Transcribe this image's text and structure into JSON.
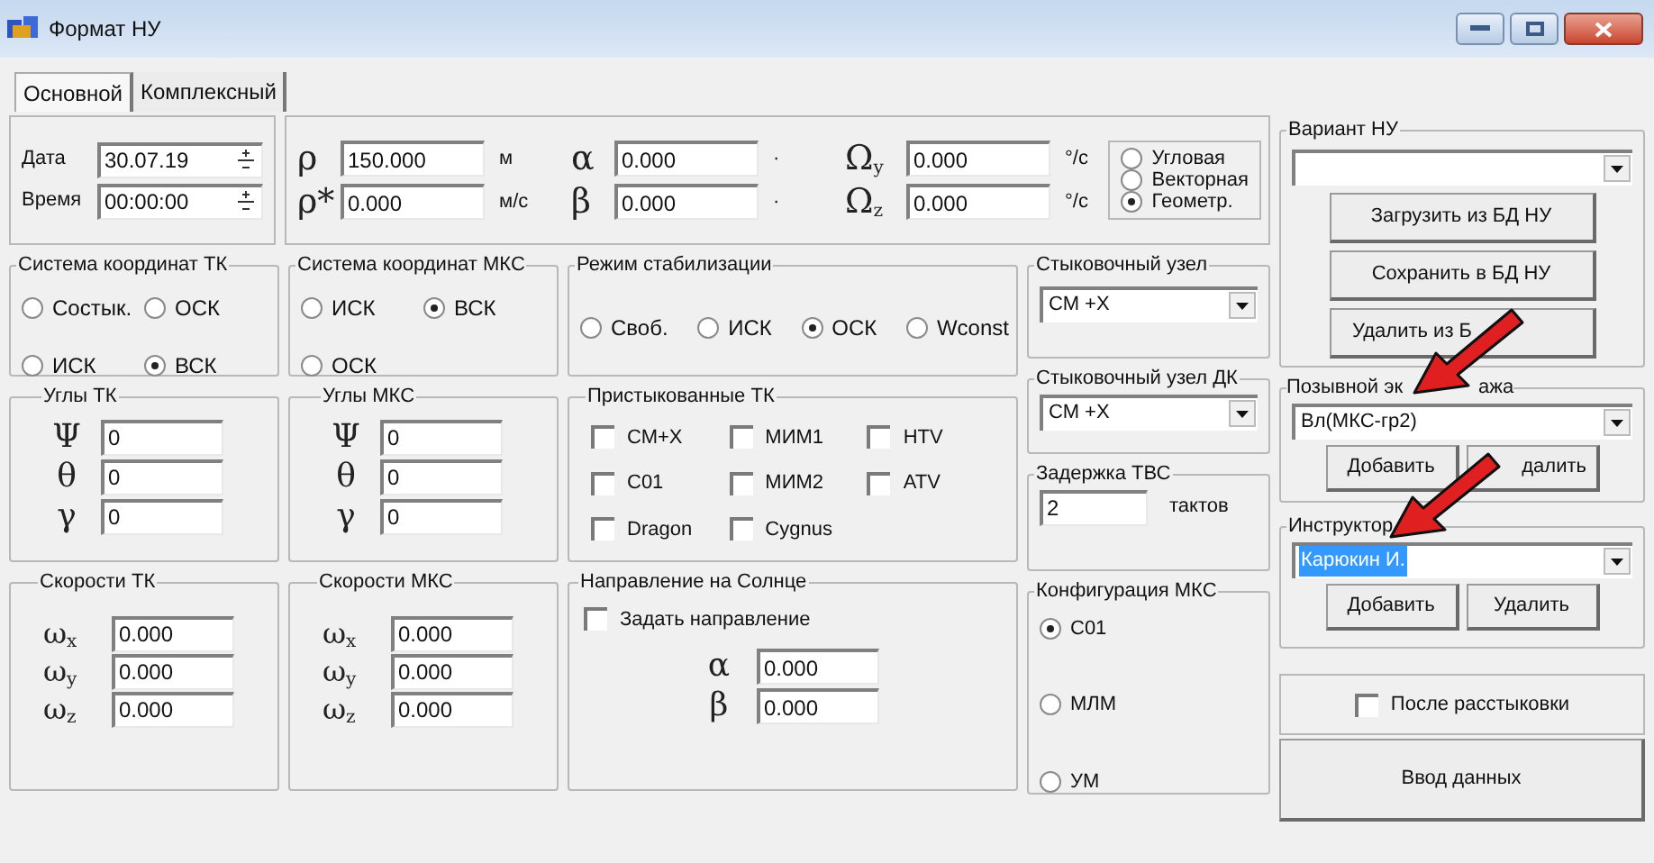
{
  "window": {
    "title": "Формат НУ"
  },
  "tabs": [
    {
      "label": "Основной",
      "selected": true
    },
    {
      "label": "Комплексный",
      "selected": false
    }
  ],
  "datetime": [
    {
      "label": "Дата",
      "value": "30.07.19"
    },
    {
      "label": "Время",
      "value": "00:00:00"
    }
  ],
  "params": [
    {
      "symbol": "ρ",
      "value": "150.000",
      "unit": "м"
    },
    {
      "symbol": "ρ*",
      "value": "0.000",
      "unit": "м/с"
    },
    {
      "symbol": "α",
      "value": "0.000",
      "unit": "·"
    },
    {
      "symbol": "β",
      "value": "0.000",
      "unit": "·"
    },
    {
      "symbol": "Ω",
      "sub": "y",
      "value": "0.000",
      "unit": "°/c"
    },
    {
      "symbol": "Ω",
      "sub": "z",
      "value": "0.000",
      "unit": "°/c"
    }
  ],
  "view_mode": [
    {
      "label": "Угловая",
      "selected": false
    },
    {
      "label": "Векторная",
      "selected": false
    },
    {
      "label": "Геометр.",
      "selected": true
    }
  ],
  "coord_tk": {
    "title": "Система координат ТК",
    "options": [
      {
        "label": "Состык.",
        "selected": false
      },
      {
        "label": "ОСК",
        "selected": false
      },
      {
        "label": "ИСК",
        "selected": false
      },
      {
        "label": "ВСК",
        "selected": true
      }
    ]
  },
  "coord_mks": {
    "title": "Система координат МКС",
    "options": [
      {
        "label": "ИСК",
        "selected": false
      },
      {
        "label": "ВСК",
        "selected": true
      },
      {
        "label": "ОСК",
        "selected": false
      }
    ]
  },
  "stabilization": {
    "title": "Режим стабилизации",
    "options": [
      {
        "label": "Своб.",
        "selected": false
      },
      {
        "label": "ИСК",
        "selected": false
      },
      {
        "label": "ОСК",
        "selected": true
      },
      {
        "label": "Wconst",
        "selected": false
      }
    ]
  },
  "docking_port": {
    "title": "Стыковочный узел",
    "value": "СМ +Х"
  },
  "docking_port_dk": {
    "title": "Стыковочный узел ДК",
    "value": "СМ +Х"
  },
  "angles_tk": {
    "title": "Углы ТК",
    "rows": [
      {
        "symbol": "Ψ",
        "value": "0"
      },
      {
        "symbol": "θ",
        "value": "0"
      },
      {
        "symbol": "γ",
        "value": "0"
      }
    ]
  },
  "angles_mks": {
    "title": "Углы МКС",
    "rows": [
      {
        "symbol": "Ψ",
        "value": "0"
      },
      {
        "symbol": "θ",
        "value": "0"
      },
      {
        "symbol": "γ",
        "value": "0"
      }
    ]
  },
  "docked": {
    "title": "Пристыкованные ТК",
    "items": [
      {
        "label": "СМ+Х",
        "checked": false
      },
      {
        "label": "МИМ1",
        "checked": false
      },
      {
        "label": "HTV",
        "checked": false
      },
      {
        "label": "С01",
        "checked": false
      },
      {
        "label": "МИМ2",
        "checked": false
      },
      {
        "label": "ATV",
        "checked": false
      },
      {
        "label": "Dragon",
        "checked": false
      },
      {
        "label": "Cygnus",
        "checked": false
      }
    ]
  },
  "tvs_delay": {
    "title": "Задержка ТВС",
    "value": "2",
    "unit": "тактов"
  },
  "speeds_tk": {
    "title": "Скорости ТК",
    "rows": [
      {
        "symbol": "ω",
        "sub": "x",
        "value": "0.000"
      },
      {
        "symbol": "ω",
        "sub": "y",
        "value": "0.000"
      },
      {
        "symbol": "ω",
        "sub": "z",
        "value": "0.000"
      }
    ]
  },
  "speeds_mks": {
    "title": "Скорости МКС",
    "rows": [
      {
        "symbol": "ω",
        "sub": "x",
        "value": "0.000"
      },
      {
        "symbol": "ω",
        "sub": "y",
        "value": "0.000"
      },
      {
        "symbol": "ω",
        "sub": "z",
        "value": "0.000"
      }
    ]
  },
  "sun": {
    "title": "Направление на Солнце",
    "checkbox": {
      "label": "Задать направление",
      "checked": false
    },
    "rows": [
      {
        "symbol": "α",
        "value": "0.000"
      },
      {
        "symbol": "β",
        "value": "0.000"
      }
    ]
  },
  "config": {
    "title": "Конфигурация МКС",
    "options": [
      {
        "label": "С01",
        "selected": true
      },
      {
        "label": "МЛМ",
        "selected": false
      },
      {
        "label": "УМ",
        "selected": false
      }
    ]
  },
  "variant": {
    "title": "Вариант НУ",
    "buttons": [
      "Загрузить из БД НУ",
      "Сохранить в БД НУ",
      "Удалить из Б"
    ]
  },
  "callsign": {
    "title_parts": [
      "Позывной эк",
      "ажа"
    ],
    "value": "Вл(МКС-гр2)",
    "buttons": [
      "Добавить",
      "далить"
    ]
  },
  "instructor": {
    "title": "Инструктор",
    "value": "Карюкин И.",
    "value_selected": true,
    "buttons": [
      "Добавить",
      "Удалить"
    ]
  },
  "after_undock": {
    "label": "После расстыковки",
    "checked": false
  },
  "submit": {
    "label": "Ввод данных"
  }
}
